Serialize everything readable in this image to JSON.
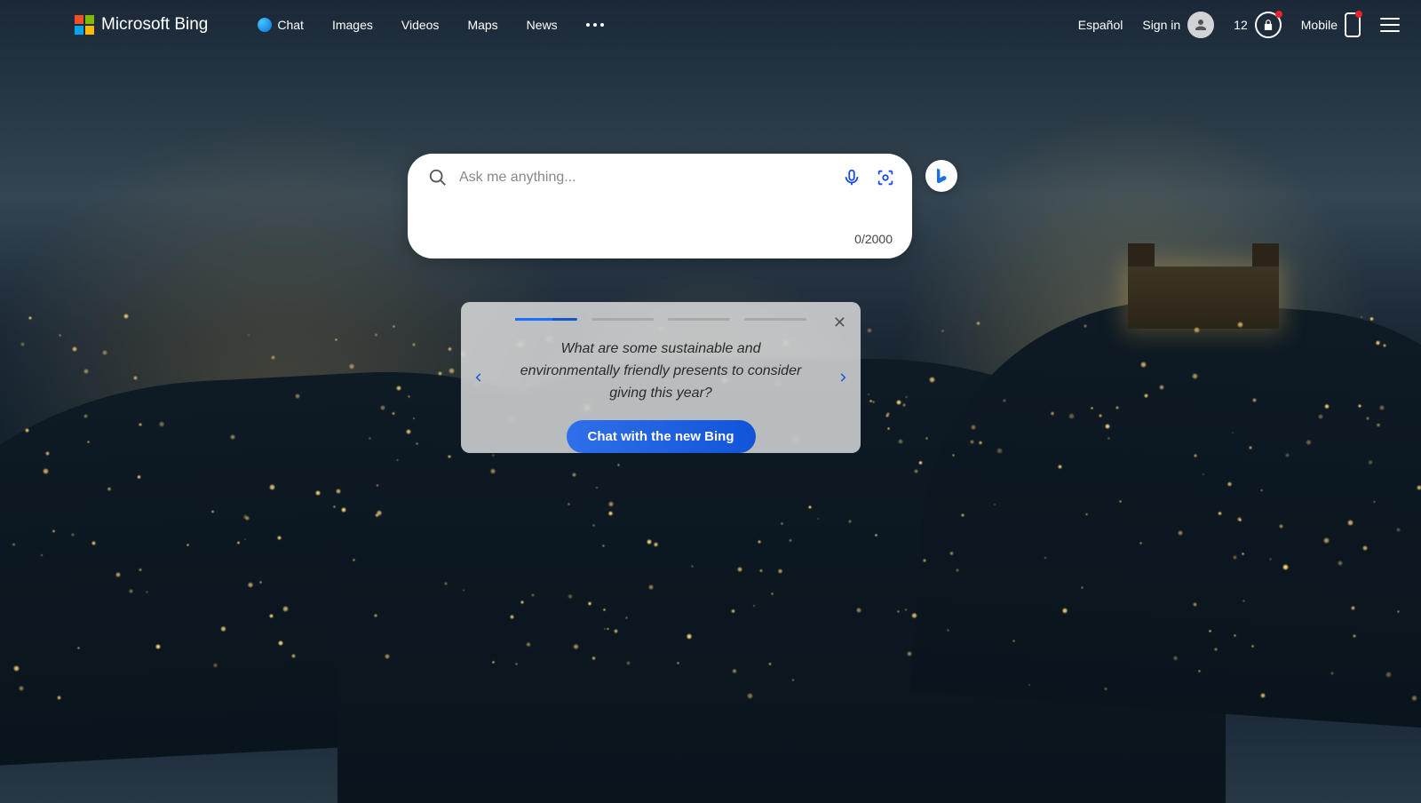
{
  "header": {
    "brand": "Microsoft Bing",
    "nav": {
      "chat": "Chat",
      "images": "Images",
      "videos": "Videos",
      "maps": "Maps",
      "news": "News"
    },
    "right": {
      "language": "Español",
      "signin": "Sign in",
      "rewards_points": "12",
      "mobile": "Mobile"
    }
  },
  "search": {
    "placeholder": "Ask me anything...",
    "value": "",
    "counter": "0/2000"
  },
  "promo": {
    "question": "What are some sustainable and environmentally friendly presents to consider giving this year?",
    "cta": "Chat with the new Bing",
    "slides_total": 4,
    "slide_active_index": 0
  }
}
